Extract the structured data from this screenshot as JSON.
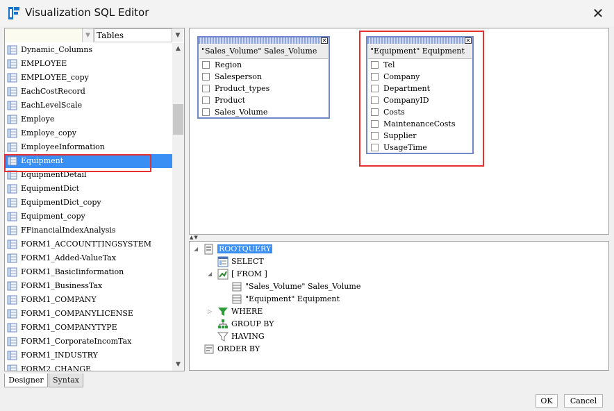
{
  "window": {
    "title": "Visualization SQL Editor"
  },
  "left_panel": {
    "filter_value": "",
    "combo_value": "Tables",
    "tables": [
      "Dynamic_Columns",
      "EMPLOYEE",
      "EMPLOYEE_copy",
      "EachCostRecord",
      "EachLevelScale",
      "Employe",
      "Employe_copy",
      "EmployeeInformation",
      "Equipment",
      "EquipmentDetail",
      "EquipmentDict",
      "EquipmentDict_copy",
      "Equipment_copy",
      "FFinancialIndexAnalysis",
      "FORM1_ACCOUNTTINGSYSTEM",
      "FORM1_Added-ValueTax",
      "FORM1_BasicIinformation",
      "FORM1_BusinessTax",
      "FORM1_COMPANY",
      "FORM1_COMPANYLICENSE",
      "FORM1_COMPANYTYPE",
      "FORM1_CorporateIncomTax",
      "FORM1_INDUSTRY",
      "FORM2_CHANGE"
    ],
    "selected_table": "Equipment"
  },
  "tabs": [
    {
      "label": "Designer",
      "active": true
    },
    {
      "label": "Syntax",
      "active": false
    }
  ],
  "design_tables": [
    {
      "title": "\"Sales_Volume\" Sales_Volume",
      "fields": [
        "Region",
        "Salesperson",
        "Product_types",
        "Product",
        "Sales_Volume"
      ]
    },
    {
      "title": "\"Equipment\" Equipment",
      "fields": [
        "Tel",
        "Company",
        "Department",
        "CompanyID",
        "Costs",
        "MaintenanceCosts",
        "Supplier",
        "UsageTime"
      ]
    }
  ],
  "query_tree": {
    "root": "ROOTQUERY",
    "select": "SELECT",
    "from": "[ FROM ]",
    "from_items": [
      "\"Sales_Volume\" Sales_Volume",
      "\"Equipment\" Equipment"
    ],
    "where": "WHERE",
    "group_by": "GROUP BY",
    "having": "HAVING",
    "order_by": "ORDER BY"
  },
  "buttons": {
    "ok": "OK",
    "cancel": "Cancel"
  },
  "colors": {
    "selection": "#3a8ff5",
    "highlight_border": "#e53030",
    "table_border": "#7289c9"
  }
}
